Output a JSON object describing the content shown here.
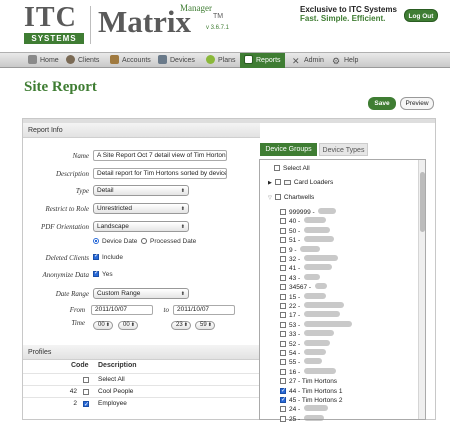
{
  "header": {
    "logo_itc": "ITC",
    "logo_systems": "SYSTEMS",
    "logo_matrix": "Matrix",
    "logo_manager": "Manager",
    "logo_tm": "TM",
    "version": "v 3.6.7.1",
    "tagline1": "Exclusive to ITC Systems",
    "tagline2": "Fast. Simple. Efficient.",
    "logout": "Log Out"
  },
  "nav": [
    {
      "label": "Home",
      "icon": "home-icon",
      "color": "#8a8a8a"
    },
    {
      "label": "Clients",
      "icon": "clients-icon",
      "color": "#7a6a55"
    },
    {
      "label": "Accounts",
      "icon": "accounts-icon",
      "color": "#a07a40"
    },
    {
      "label": "Devices",
      "icon": "devices-icon",
      "color": "#6a7a8a"
    },
    {
      "label": "Plans",
      "icon": "plans-icon",
      "color": "#8ab83a"
    },
    {
      "label": "Reports",
      "icon": "reports-icon",
      "color": "#ffffff"
    },
    {
      "label": "Admin",
      "icon": "admin-icon",
      "color": "#555555"
    },
    {
      "label": "Help",
      "icon": "help-icon",
      "color": "#555555"
    }
  ],
  "page": {
    "title": "Site Report",
    "save": "Save",
    "preview": "Preview"
  },
  "report_info": {
    "header": "Report Info",
    "name_label": "Name",
    "name_value": "A Site Report Oct 7 detail view of Tim Hortons",
    "description_label": "Description",
    "description_value": "Detail report for Tim Hortons sorted by device",
    "type_label": "Type",
    "type_value": "Detail",
    "restrict_label": "Restrict to Role",
    "restrict_value": "Unrestricted",
    "orientation_label": "PDF Orientation",
    "orientation_value": "Landscape",
    "radio_device_date": "Device Date",
    "radio_processed_date": "Processed Date",
    "deleted_label": "Deleted Clients",
    "deleted_value": "Include",
    "anonymize_label": "Anonymize Data",
    "anonymize_value": "Yes",
    "date_range_label": "Date Range",
    "date_range_value": "Custom Range",
    "from_label": "From",
    "from_date": "2011/10/07",
    "to_label": "to",
    "to_date": "2011/10/07",
    "time_label": "Time",
    "from_hour": "00",
    "from_min": "00",
    "to_hour": "23",
    "to_min": "59"
  },
  "profiles": {
    "header": "Profiles",
    "col_code": "Code",
    "col_description": "Description",
    "rows": [
      {
        "code": "",
        "description": "Select All",
        "checked": false
      },
      {
        "code": "42",
        "description": "Cool People",
        "checked": false
      },
      {
        "code": "2",
        "description": "Employee",
        "checked": true
      }
    ]
  },
  "device_panel": {
    "tab_groups": "Device Groups",
    "tab_types": "Device Types",
    "select_all": "Select All",
    "groups": [
      {
        "label": "Card Loaders",
        "expanded": false
      },
      {
        "label": "Chartwells",
        "expanded": true
      }
    ],
    "devices": [
      {
        "code": "999999",
        "name": "",
        "checked": false
      },
      {
        "code": "40",
        "name": "",
        "checked": false
      },
      {
        "code": "50",
        "name": "",
        "checked": false
      },
      {
        "code": "51",
        "name": "",
        "checked": false
      },
      {
        "code": "9",
        "name": "",
        "checked": false
      },
      {
        "code": "32",
        "name": "",
        "checked": false
      },
      {
        "code": "41",
        "name": "",
        "checked": false
      },
      {
        "code": "43",
        "name": "",
        "checked": false
      },
      {
        "code": "34567",
        "name": "",
        "checked": false
      },
      {
        "code": "15",
        "name": "",
        "checked": false
      },
      {
        "code": "22",
        "name": "",
        "checked": false
      },
      {
        "code": "17",
        "name": "",
        "checked": false
      },
      {
        "code": "53",
        "name": "",
        "checked": false
      },
      {
        "code": "33",
        "name": "",
        "checked": false
      },
      {
        "code": "52",
        "name": "",
        "checked": false
      },
      {
        "code": "54",
        "name": "",
        "checked": false
      },
      {
        "code": "55",
        "name": "",
        "checked": false
      },
      {
        "code": "16",
        "name": "",
        "checked": false
      },
      {
        "code": "27",
        "name": "Tim Hortons",
        "checked": false
      },
      {
        "code": "44",
        "name": "Tim Hortons 1",
        "checked": true
      },
      {
        "code": "45",
        "name": "Tim Hortons 2",
        "checked": true
      },
      {
        "code": "24",
        "name": "",
        "checked": false
      },
      {
        "code": "25",
        "name": "",
        "checked": false
      }
    ]
  },
  "colors": {
    "brand_green": "#3f7d33",
    "check_blue": "#2a6ad8"
  }
}
